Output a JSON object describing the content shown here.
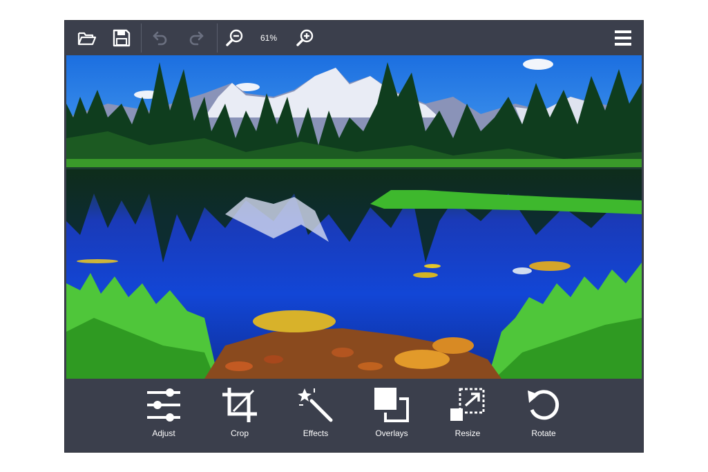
{
  "toolbar": {
    "open_icon": "folder-open-icon",
    "save_icon": "save-icon",
    "undo_icon": "undo-icon",
    "redo_icon": "redo-icon",
    "zoom_out_icon": "zoom-out-icon",
    "zoom_level": "61%",
    "zoom_in_icon": "zoom-in-icon",
    "menu_icon": "hamburger-menu-icon"
  },
  "image": {
    "description_icon": "landscape-photo"
  },
  "tools": [
    {
      "label": "Adjust",
      "icon": "sliders-icon"
    },
    {
      "label": "Crop",
      "icon": "crop-icon"
    },
    {
      "label": "Effects",
      "icon": "magic-wand-icon"
    },
    {
      "label": "Overlays",
      "icon": "overlays-icon"
    },
    {
      "label": "Resize",
      "icon": "resize-icon"
    },
    {
      "label": "Rotate",
      "icon": "rotate-icon"
    }
  ],
  "colors": {
    "panel": "#3b3f4c",
    "icon": "#ffffff",
    "icon_disabled": "#6b7080"
  }
}
